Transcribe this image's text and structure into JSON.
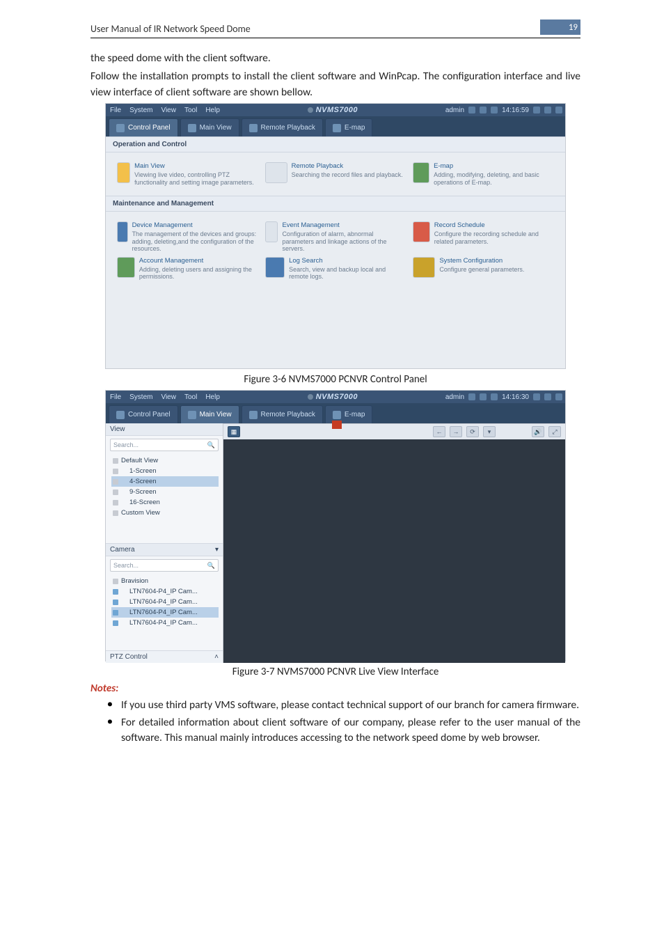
{
  "header": {
    "title": "User Manual of IR Network Speed Dome",
    "page_number": "19"
  },
  "paragraphs": {
    "p1": "the speed dome with the client software.",
    "p2": "Follow the installation prompts to install the client software and WinPcap. The configuration interface and live view interface of client software are shown bellow."
  },
  "figcap1": "Figure 3-6 NVMS7000 PCNVR Control Panel",
  "figcap2": "Figure 3-7 NVMS7000 PCNVR Live View Interface",
  "notes_heading": "Notes:",
  "notes": [
    "If you use third party VMS software, please contact technical support of our branch for camera firmware.",
    "For detailed information about client software of our company, please refer to the user manual of the software. This manual mainly introduces accessing to the network speed dome by web browser."
  ],
  "shot1": {
    "menu": [
      "File",
      "System",
      "View",
      "Tool",
      "Help"
    ],
    "app_title": "NVMS7000",
    "right": {
      "user": "admin",
      "time": "14:16:59"
    },
    "tabs": [
      {
        "label": "Control Panel",
        "active": true
      },
      {
        "label": "Main View"
      },
      {
        "label": "Remote Playback"
      },
      {
        "label": "E-map"
      }
    ],
    "sections": [
      {
        "title": "Operation and Control",
        "tiles": [
          {
            "title": "Main View",
            "desc": "Viewing live video, controlling PTZ functionality and setting image parameters."
          },
          {
            "title": "Remote Playback",
            "desc": "Searching the record files and playback."
          },
          {
            "title": "E-map",
            "desc": "Adding, modifying, deleting, and basic operations of E-map."
          }
        ]
      },
      {
        "title": "Maintenance and Management",
        "tiles": [
          {
            "title": "Device Management",
            "desc": "The management of the devices and groups: adding, deleting,and the configuration of the resources."
          },
          {
            "title": "Event Management",
            "desc": "Configuration of alarm, abnormal parameters and linkage actions of the servers."
          },
          {
            "title": "Record Schedule",
            "desc": "Configure the recording schedule and related parameters."
          },
          {
            "title": "Account Management",
            "desc": "Adding, deleting users and assigning the permissions."
          },
          {
            "title": "Log Search",
            "desc": "Search, view and backup local and remote logs."
          },
          {
            "title": "System Configuration",
            "desc": "Configure general parameters."
          }
        ]
      }
    ]
  },
  "shot2": {
    "menu": [
      "File",
      "System",
      "View",
      "Tool",
      "Help"
    ],
    "app_title": "NVMS7000",
    "right": {
      "user": "admin",
      "time": "14:16:30"
    },
    "tabs": [
      {
        "label": "Control Panel"
      },
      {
        "label": "Main View",
        "active": true
      },
      {
        "label": "Remote Playback"
      },
      {
        "label": "E-map"
      }
    ],
    "view_panel": {
      "header": "View",
      "search_placeholder": "Search...",
      "tree": [
        {
          "label": "Default View",
          "kind": "folder"
        },
        {
          "label": "1-Screen",
          "kind": "item"
        },
        {
          "label": "4-Screen",
          "kind": "item",
          "selected": true
        },
        {
          "label": "9-Screen",
          "kind": "item"
        },
        {
          "label": "16-Screen",
          "kind": "item"
        },
        {
          "label": "Custom View",
          "kind": "folder"
        }
      ]
    },
    "camera_panel": {
      "header": "Camera",
      "search_placeholder": "Search...",
      "group": "Bravision",
      "items": [
        {
          "label": "LTN7604-P4_IP Cam..."
        },
        {
          "label": "LTN7604-P4_IP Cam..."
        },
        {
          "label": "LTN7604-P4_IP Cam...",
          "selected": true
        },
        {
          "label": "LTN7604-P4_IP Cam..."
        }
      ]
    },
    "ptz_label": "PTZ Control"
  }
}
